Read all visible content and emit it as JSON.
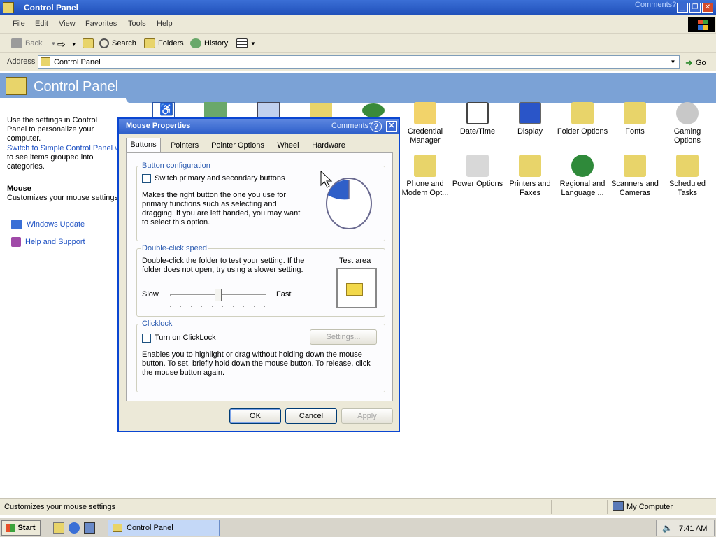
{
  "window": {
    "title": "Control Panel",
    "comments_link": "Comments?",
    "minimize": "_",
    "restore": "❐",
    "close": "✕"
  },
  "menu": [
    "File",
    "Edit",
    "View",
    "Favorites",
    "Tools",
    "Help"
  ],
  "toolbar": {
    "back": "Back",
    "search": "Search",
    "folders": "Folders",
    "history": "History"
  },
  "address": {
    "label": "Address",
    "value": "Control Panel",
    "go": "Go"
  },
  "header": {
    "title": "Control Panel"
  },
  "left_panel": {
    "intro": "Use the settings in Control Panel to personalize your computer.",
    "switch_link": "Switch to Simple Control Panel view",
    "switch_tail": "to see items grouped into categories.",
    "selected_title": "Mouse",
    "selected_desc": "Customizes your mouse settings",
    "links": [
      "Windows Update",
      "Help and Support"
    ]
  },
  "icons": {
    "row1": [
      "Credential Manager",
      "Date/Time",
      "Display",
      "Folder Options",
      "Fonts",
      "Gaming Options"
    ],
    "row2": [
      "Phone and Modem Opt...",
      "Power Options",
      "Printers and Faxes",
      "Regional and Language ...",
      "Scanners and Cameras",
      "Scheduled Tasks"
    ]
  },
  "dialog": {
    "title": "Mouse Properties",
    "comments": "Comments?",
    "help": "?",
    "close": "✕",
    "tabs": [
      "Buttons",
      "Pointers",
      "Pointer Options",
      "Wheel",
      "Hardware"
    ],
    "active_tab": "Buttons",
    "button_config": {
      "title": "Button configuration",
      "checkbox_label": "Switch primary and secondary buttons",
      "checked": false,
      "description": "Makes the right button the one you use for primary functions such as selecting and dragging.  If you are left handed, you may want to select this option."
    },
    "double_click": {
      "title": "Double-click speed",
      "description": "Double-click the folder to test your setting.  If the folder does not open, try using a slower setting.",
      "test_area": "Test area",
      "slow": "Slow",
      "fast": "Fast",
      "slider_value": 0.5
    },
    "clicklock": {
      "title": "Clicklock",
      "checkbox_label": "Turn on ClickLock",
      "checked": false,
      "settings_button": "Settings...",
      "description": "Enables you to highlight or drag without holding down the mouse button.  To set, briefly hold down the mouse button.  To release, click the mouse button again."
    },
    "buttons": {
      "ok": "OK",
      "cancel": "Cancel",
      "apply": "Apply"
    }
  },
  "status": {
    "text": "Customizes your mouse settings",
    "zone": "My Computer"
  },
  "taskbar": {
    "start": "Start",
    "task": "Control Panel",
    "clock": "7:41 AM"
  }
}
